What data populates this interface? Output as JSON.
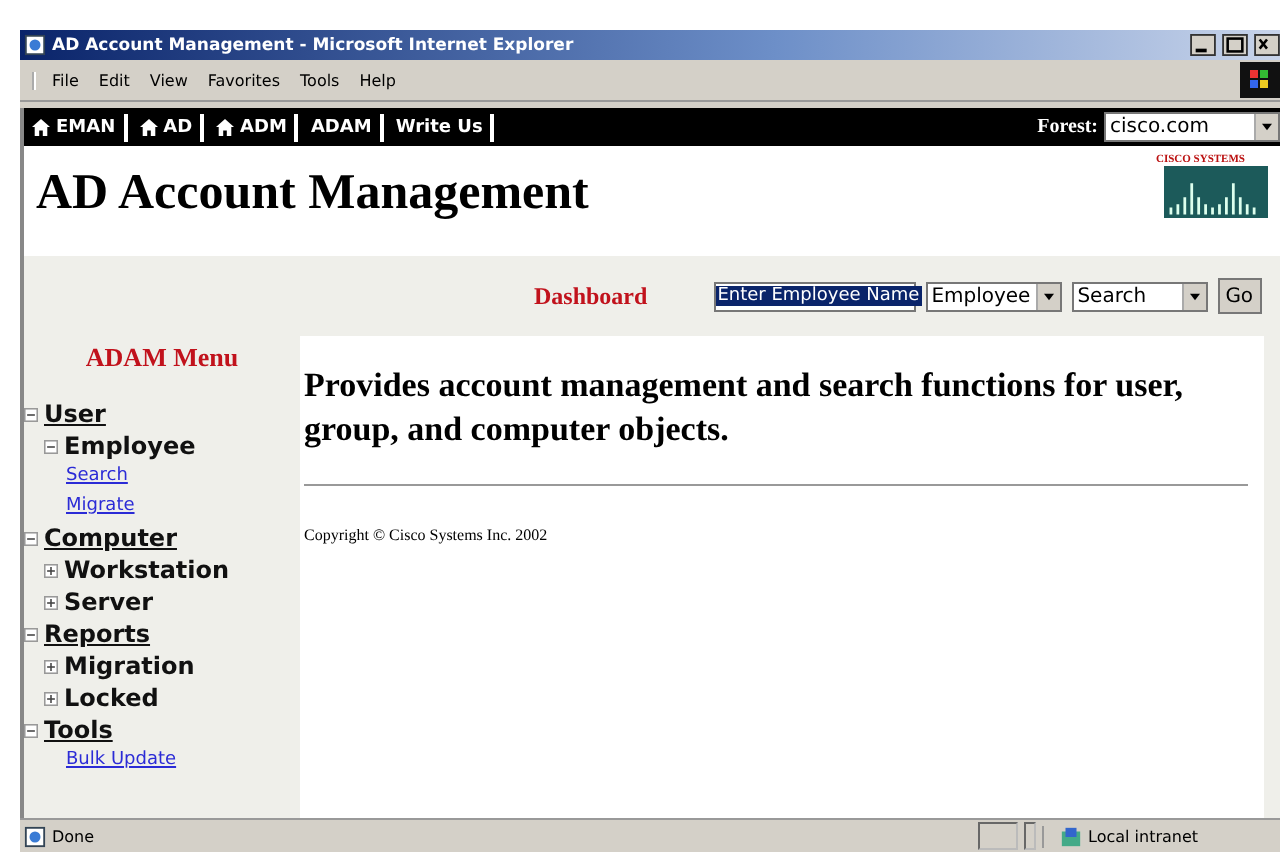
{
  "window": {
    "title": "AD Account Management - Microsoft Internet Explorer"
  },
  "menu_bar": [
    "File",
    "Edit",
    "View",
    "Favorites",
    "Tools",
    "Help"
  ],
  "nav_links": [
    {
      "label": "EMAN",
      "kind": "home"
    },
    {
      "label": "AD",
      "kind": "home"
    },
    {
      "label": "ADM",
      "kind": "home"
    },
    {
      "label": "ADAM",
      "kind": "plain"
    },
    {
      "label": "Write Us",
      "kind": "plain"
    }
  ],
  "forest": {
    "label": "Forest:",
    "value": "cisco.com"
  },
  "page_title": "AD Account Management",
  "logo_text": "CISCO SYSTEMS",
  "dashboard": {
    "label": "Dashboard",
    "search_value": "Enter Employee Name",
    "type_select": "Employee",
    "action_select": "Search",
    "button": "Go"
  },
  "sidebar": {
    "title": "ADAM Menu",
    "items": [
      {
        "label": "User",
        "expanded": true,
        "children": [
          {
            "label": "Employee",
            "expanded": true,
            "children": [
              {
                "label": "Search"
              },
              {
                "label": "Migrate"
              }
            ]
          }
        ]
      },
      {
        "label": "Computer",
        "expanded": true,
        "children": [
          {
            "label": "Workstation",
            "expanded": false
          },
          {
            "label": "Server",
            "expanded": false
          }
        ]
      },
      {
        "label": "Reports",
        "expanded": true,
        "children": [
          {
            "label": "Migration",
            "expanded": false
          },
          {
            "label": "Locked",
            "expanded": false
          }
        ]
      },
      {
        "label": "Tools",
        "expanded": true,
        "children": [
          {
            "label": "Bulk Update"
          }
        ]
      }
    ]
  },
  "content": {
    "description": "Provides account management and search functions for user, group, and computer objects.",
    "copyright": "Copyright © Cisco Systems Inc. 2002"
  },
  "status_bar": {
    "status": "Done",
    "zone": "Local intranet"
  }
}
